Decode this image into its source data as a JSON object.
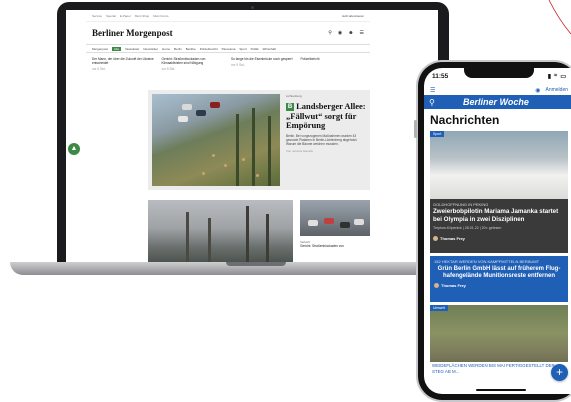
{
  "colors": {
    "accent_green": "#3c8a45",
    "accent_blue": "#1f5fb5",
    "deco_red": "#c8202a"
  },
  "laptop": {
    "top_links": [
      "Service",
      "Spezial",
      "E-Paper",
      "Mein Shop",
      "Mein Konto"
    ],
    "login_label": "Jetzt abonnieren",
    "logo": "Berliner Morgenpost",
    "icons": [
      "search-icon",
      "location-icon",
      "user-icon",
      "menu-icon"
    ],
    "nav": [
      "Morgenpost",
      "Abo",
      "Newsletter",
      "Newsticker",
      "Home",
      "Berlin",
      "Bezirke",
      "Polizeibericht",
      "Panorama",
      "Sport",
      "Politik",
      "Wirtschaft"
    ],
    "teasers": [
      {
        "text": "Der Mann, der über die Zukunft der Ukraine entscheidet",
        "date": "vor 6 Std."
      },
      {
        "text": "Gericht: Straßenblockaden von Klimaaktivisten sind Nötigung",
        "date": "vor 6 Std."
      },
      {
        "text": "So lange bis die Eisenbrücke noch gesperrt",
        "date": "vor 9 Std."
      },
      {
        "text": "Polizeibericht",
        "date": ""
      }
    ],
    "hero": {
      "kicker": "Lichtenberg",
      "headline": "Landsberger Allee: „Fällwut“ sorgt für Empörung",
      "summary": "Berlin. Bei vorgezogenen Maßnahmen wurden 43 gesunde Platanen in Berlin-Lichtenberg abgeholzt. Warum die Bäume weichen mussten.",
      "author": "Von Jessica Hanack"
    },
    "second": {
      "kicker": "Verkehr",
      "headline": "Gericht: Straßenblockaden von"
    }
  },
  "phone": {
    "time": "11:55",
    "login_label": "Anmelden",
    "brand": "Berliner Woche",
    "section": "Nachrichten",
    "card1": {
      "tag": "Sport",
      "kicker": "GOLDHOFFNUNG IN PEKING",
      "headline": "Zweierbobpilotin Mariama Jamanka startet bei Olympia in zwei Disziplinen",
      "meta": "Treptow-Köpenick | 28.01.22 | 20× gelesen",
      "author": "Thomas Frey"
    },
    "card2": {
      "kicker": "152 HEKTAR WERDEN VON KAMPFMITTELN BERÄUMT",
      "headline": "Grün Berlin GmbH lässt auf früherem Flug-hafengelände Munitionsreste entfernen",
      "author": "Thomas Frey"
    },
    "card3": {
      "tag": "Umwelt",
      "caption": "WEIDEFLÄCHEN WERDEN BIS MAI FERTIGGESTELLT DER STEG AB M..."
    },
    "fab_label": "+"
  }
}
